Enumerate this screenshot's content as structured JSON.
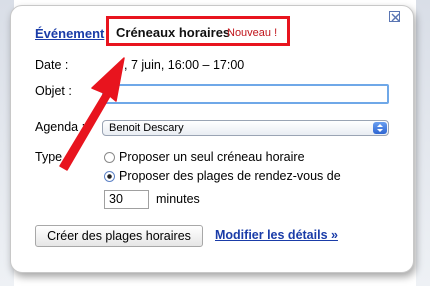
{
  "tabs": {
    "event_label": "Événement",
    "slots_label": "Créneaux horaires",
    "slots_badge": "Nouveau !"
  },
  "form": {
    "date_label": "Date :",
    "date_value": ", 7 juin, 16:00 – 17:00",
    "objet_label": "Objet :",
    "objet_value": "",
    "agenda_label": "Agenda :",
    "agenda_value": "Benoit Descary",
    "type_label": "Type :",
    "type_options": [
      {
        "label": "Proposer un seul créneau horaire",
        "checked": false
      },
      {
        "label": "Proposer des plages de rendez-vous de",
        "checked": true
      }
    ],
    "duration_value": "30",
    "duration_unit": "minutes"
  },
  "actions": {
    "create_label": "Créer des plages horaires",
    "details_label": "Modifier les détails »"
  },
  "colors": {
    "highlight": "#e8141e",
    "link": "#1a3ca8",
    "badge": "#c0141b"
  },
  "icons": {
    "close": "close-icon",
    "select_arrows": "select-arrows-icon",
    "annotation": "annotation-arrow"
  }
}
